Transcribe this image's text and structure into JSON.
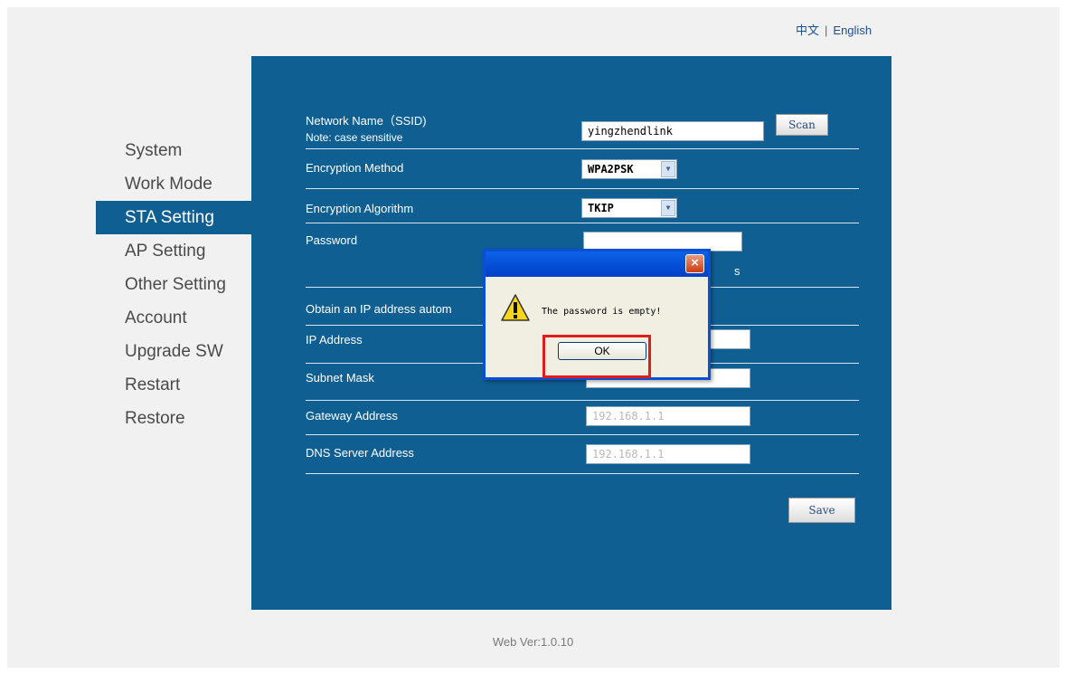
{
  "lang": {
    "chinese": "中文",
    "separator": "|",
    "english": "English"
  },
  "sidebar": {
    "items": [
      {
        "label": "System"
      },
      {
        "label": "Work Mode"
      },
      {
        "label": "STA Setting"
      },
      {
        "label": "AP Setting"
      },
      {
        "label": "Other Setting"
      },
      {
        "label": "Account"
      },
      {
        "label": "Upgrade SW"
      },
      {
        "label": "Restart"
      },
      {
        "label": "Restore"
      }
    ],
    "active": "STA Setting"
  },
  "form": {
    "ssid_label": "Network Name（SSID)",
    "ssid_note": "Note: case sensitive",
    "ssid_value": "yingzhendlink",
    "scan_label": "Scan",
    "encryption_method_label": "Encryption Method",
    "encryption_method_value": "WPA2PSK",
    "encryption_algorithm_label": "Encryption Algorithm",
    "encryption_algorithm_value": "TKIP",
    "password_label": "Password",
    "password_value": "",
    "password_partial_text": "s",
    "obtain_ip_label": "Obtain an IP address autom",
    "ip_address_label": "IP Address",
    "subnet_mask_label": "Subnet Mask",
    "gateway_label": "Gateway Address",
    "gateway_value": "192.168.1.1",
    "dns_label": "DNS Server Address",
    "dns_value": "192.168.1.1",
    "save_label": "Save"
  },
  "dialog": {
    "message": "The password is empty!",
    "ok_label": "OK",
    "close_label": "×"
  },
  "footer": {
    "version": "Web Ver:1.0.10"
  },
  "colors": {
    "panel": "#0f5f93",
    "highlight": "#e21b1b",
    "dialog_title": "#0040c8"
  }
}
